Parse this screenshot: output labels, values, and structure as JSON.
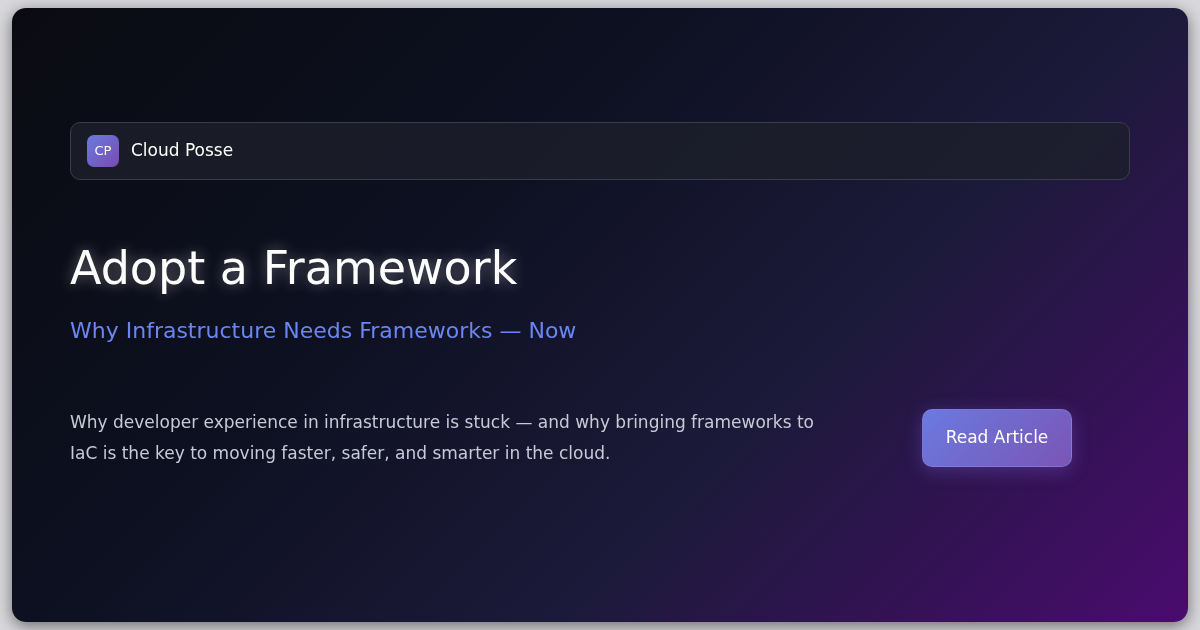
{
  "brand": {
    "logo": "CP",
    "name": "Cloud Posse"
  },
  "title": "Adopt a Framework",
  "subtitle": "Why Infrastructure Needs Frameworks — Now",
  "description": "Why developer experience in infrastructure is stuck — and why bringing frameworks to IaC is the key to moving faster, safer, and smarter in the cloud.",
  "button": "Read Article"
}
